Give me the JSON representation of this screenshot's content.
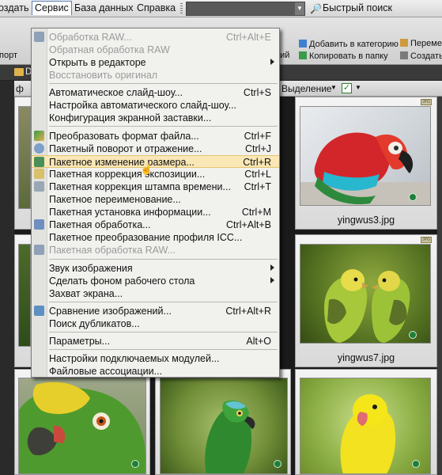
{
  "menubar": {
    "partial_left": "оздать",
    "items": [
      "Сервис",
      "База данных",
      "Справка"
    ],
    "quick_search": "Быстрый поиск"
  },
  "toolbar2": {
    "import_partial": "порт",
    "partial_label": "ний",
    "add_to_category": "Добавить в категорию",
    "move_partial": "Перемест",
    "copy_to_folder": "Копировать в папку",
    "create_partial": "Создать"
  },
  "strip": {
    "tab_partial": "D",
    "left_partial": "ф",
    "selection": "Выделение"
  },
  "colors": {
    "highlight": "#fae7b6",
    "menu_bg": "#f1f1ee",
    "accent": "#5b7fb5"
  },
  "menu": {
    "items": [
      {
        "label": "Обработка RAW...",
        "shortcut": "Ctrl+Alt+E",
        "disabled": true,
        "icon": "raw-icon"
      },
      {
        "label": "Обратная обработка RAW",
        "shortcut": "",
        "disabled": true
      },
      {
        "label": "Открыть в редакторе",
        "shortcut": "",
        "submenu": true
      },
      {
        "label": "Восстановить оригинал",
        "shortcut": "",
        "disabled": true
      },
      {
        "label": "Автоматическое слайд-шоу...",
        "shortcut": "Ctrl+S"
      },
      {
        "label": "Настройка автоматического слайд-шоу...",
        "shortcut": ""
      },
      {
        "label": "Конфигурация экранной заставки...",
        "shortcut": ""
      },
      {
        "label": "Преобразовать формат файла...",
        "shortcut": "Ctrl+F",
        "icon": "convert-icon"
      },
      {
        "label": "Пакетный поворот и отражение...",
        "shortcut": "Ctrl+J",
        "icon": "rotate-icon"
      },
      {
        "label": "Пакетное изменение размера...",
        "shortcut": "Ctrl+R",
        "highlighted": true,
        "icon": "resize-icon"
      },
      {
        "label": "Пакетная коррекция экспозиции...",
        "shortcut": "Ctrl+L",
        "icon": "exposure-icon"
      },
      {
        "label": "Пакетная коррекция штампа времени...",
        "shortcut": "Ctrl+T",
        "icon": "timestamp-icon"
      },
      {
        "label": "Пакетное переименование...",
        "shortcut": ""
      },
      {
        "label": "Пакетная установка информации...",
        "shortcut": "Ctrl+M"
      },
      {
        "label": "Пакетная обработка...",
        "shortcut": "Ctrl+Alt+B",
        "icon": "batch-icon"
      },
      {
        "label": "Пакетное преобразование профиля ICC...",
        "shortcut": ""
      },
      {
        "label": "Пакетная обработка RAW...",
        "shortcut": "",
        "disabled": true,
        "icon": "raw-icon"
      },
      {
        "label": "Звук изображения",
        "shortcut": "",
        "submenu": true
      },
      {
        "label": "Сделать фоном рабочего стола",
        "shortcut": "",
        "submenu": true
      },
      {
        "label": "Захват экрана...",
        "shortcut": ""
      },
      {
        "label": "Сравнение изображений...",
        "shortcut": "Ctrl+Alt+R",
        "icon": "compare-icon"
      },
      {
        "label": "Поиск дубликатов...",
        "shortcut": ""
      },
      {
        "label": "Параметры...",
        "shortcut": "Alt+O"
      },
      {
        "label": "Настройки подключаемых модулей...",
        "shortcut": ""
      },
      {
        "label": "Файловые ассоциации...",
        "shortcut": ""
      }
    ]
  },
  "thumbnails": [
    {
      "file": "yingwus3.jpg",
      "subject": "red-macaw"
    },
    {
      "file": "yingwus7.jpg",
      "subject": "budgerigars"
    },
    {
      "file": "",
      "subject": "amazon-parrot"
    },
    {
      "file": "",
      "subject": "green-parrot"
    },
    {
      "file": "",
      "subject": "yellow-parakeet"
    }
  ]
}
